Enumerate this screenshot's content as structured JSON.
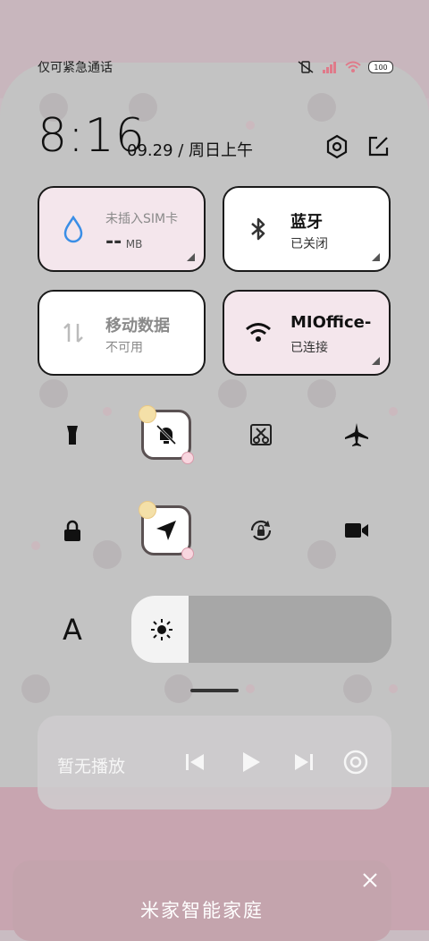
{
  "status_bar": {
    "carrier_text": "仅可紧急通话",
    "battery": "100"
  },
  "header": {
    "time": "8:16",
    "date": "09.29 / 周日上午"
  },
  "tiles": [
    {
      "title": "未插入SIM卡",
      "subtitle": "-- MB",
      "subtitle_unit": "MB",
      "subtitle_value": "--",
      "active": true,
      "icon": "water-drop-icon"
    },
    {
      "title": "蓝牙",
      "subtitle": "已关闭",
      "active": false,
      "icon": "bluetooth-icon"
    },
    {
      "title": "移动数据",
      "subtitle": "不可用",
      "active": false,
      "icon": "mobile-data-icon"
    },
    {
      "title": "MIOffice-",
      "subtitle": "已连接",
      "active": true,
      "icon": "wifi-icon"
    }
  ],
  "toggles_row1": [
    "flashlight-icon",
    "silent-bell-icon",
    "screenshot-icon",
    "airplane-icon"
  ],
  "toggles_row2": [
    "lock-icon",
    "location-icon",
    "rotation-lock-icon",
    "video-camera-icon"
  ],
  "brightness": {
    "level": 0.22,
    "font_label": "A"
  },
  "media": {
    "label": "暂无播放"
  },
  "bottom_panel": {
    "title": "米家智能家庭"
  },
  "colors": {
    "tile_active": "#f4e6ec",
    "tile_inactive": "#ffffff",
    "accent_blue": "#3a8ee6"
  }
}
